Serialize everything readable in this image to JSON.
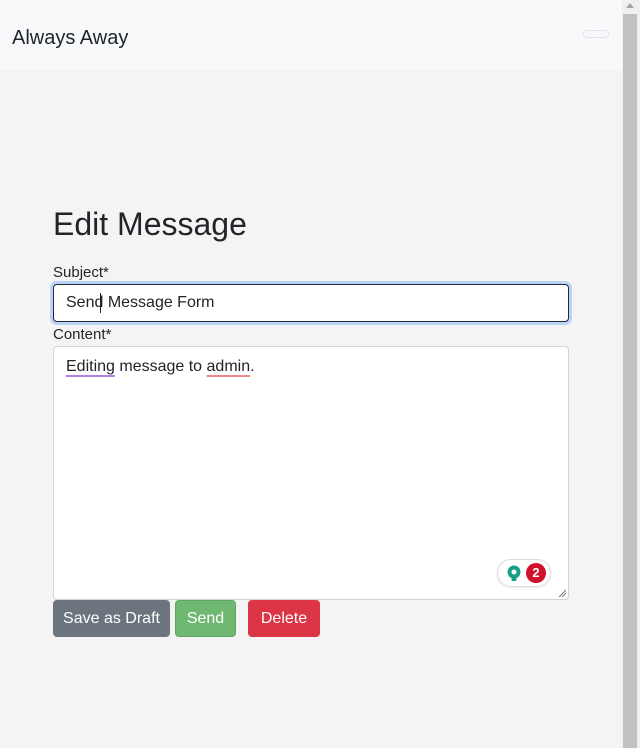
{
  "navbar": {
    "brand": "Always Away"
  },
  "form": {
    "title": "Edit Message",
    "subject_label": "Subject*",
    "subject_value": "Send Message Form",
    "content_label": "Content*",
    "content_parts": [
      "Editing",
      " message to ",
      "admin",
      "."
    ],
    "grammar_issue_count": "2"
  },
  "buttons": {
    "draft": "Save as Draft",
    "send": "Send",
    "delete": "Delete"
  },
  "icons": {
    "grammar": "lightbulb-icon",
    "toggler": "hamburger-icon"
  },
  "colors": {
    "draft": "#6c757d",
    "send": "#6fb872",
    "delete": "#dc3545",
    "badge": "#d0122a",
    "bulb": "#15a085"
  }
}
